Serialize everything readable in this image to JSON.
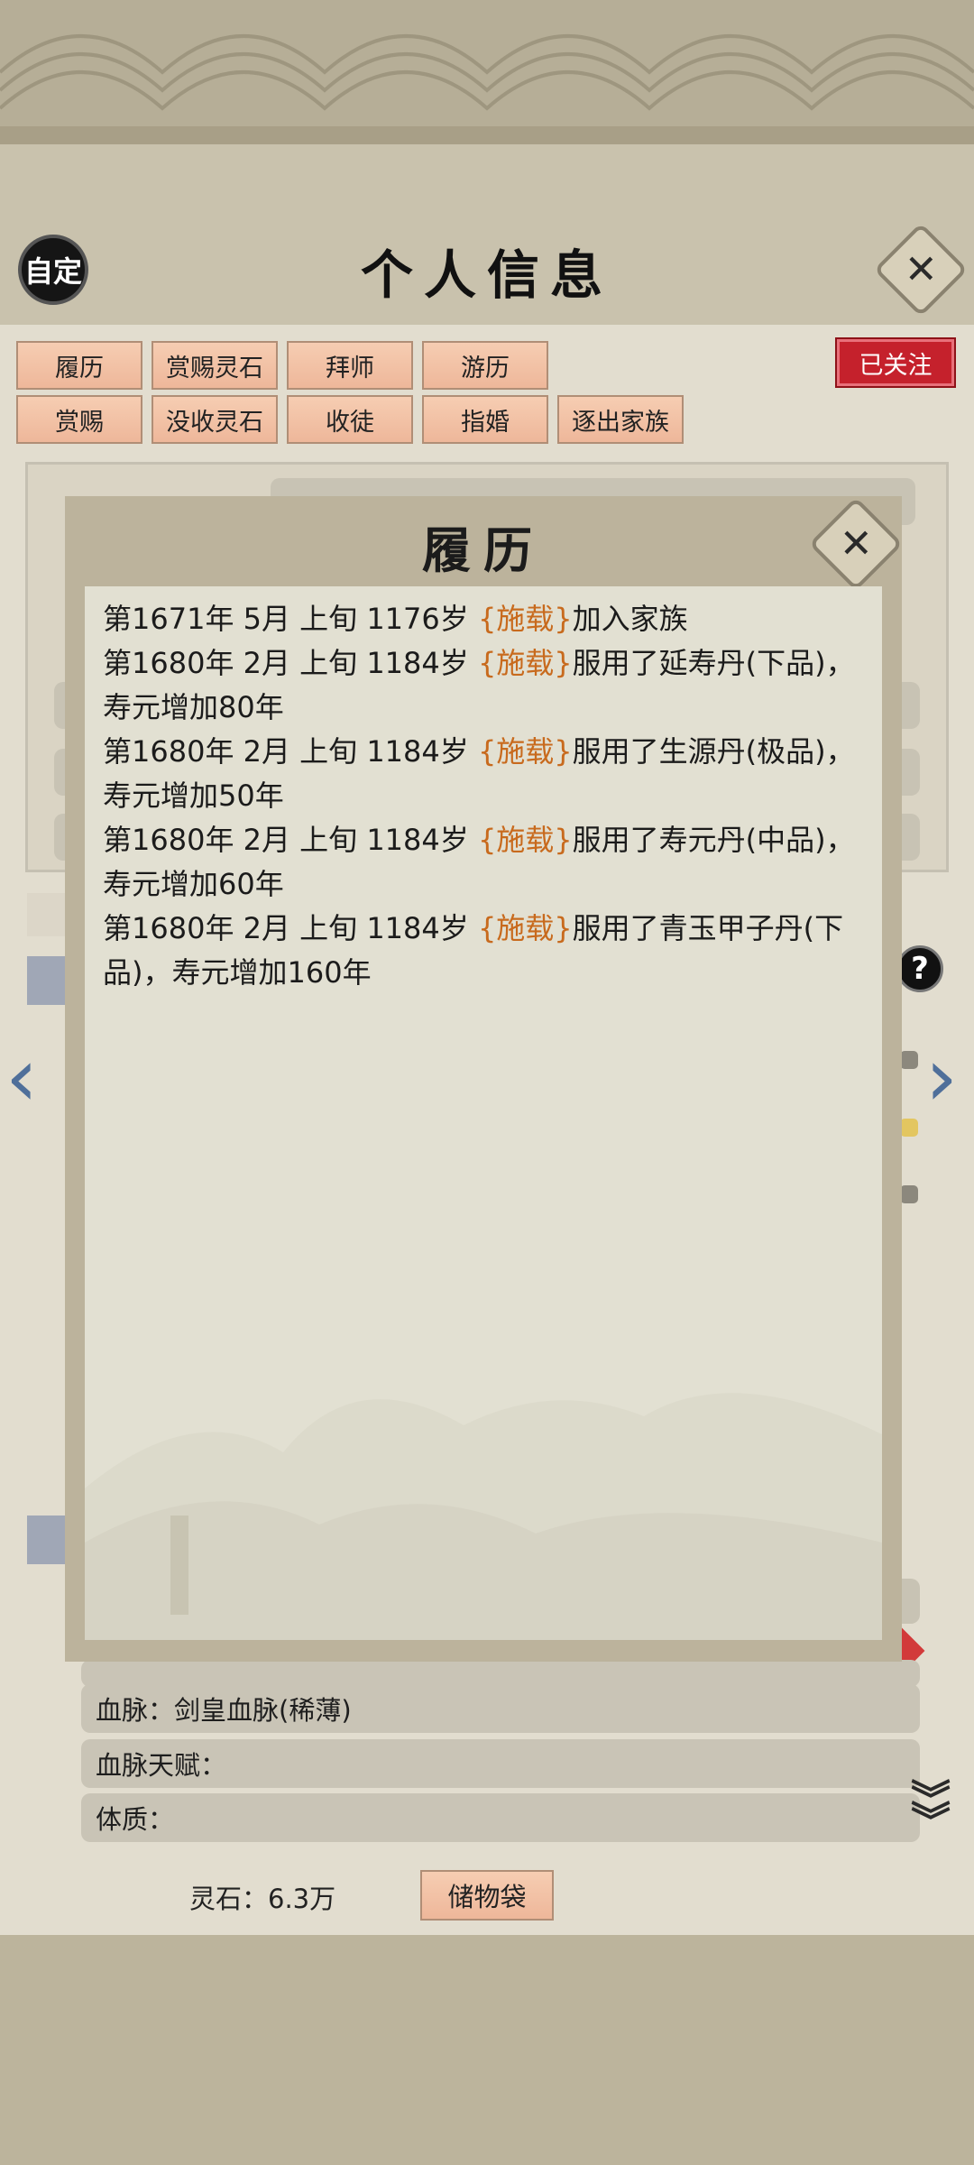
{
  "header": {
    "custom_btn": "自定",
    "title": "个人信息"
  },
  "actions": {
    "row1": [
      "履历",
      "赏赐灵石",
      "拜师",
      "游历"
    ],
    "row2": [
      "赏赐",
      "没收灵石",
      "收徒",
      "指婚",
      "逐出家族"
    ],
    "follow": "已关注"
  },
  "attributes": {
    "bloodline": "血脉：剑皇血脉(稀薄)",
    "bloodline_talent": "血脉天赋：",
    "physique": "体质："
  },
  "footer": {
    "spirit_stones": "灵石：6.3万",
    "storage_bag": "储物袋"
  },
  "modal": {
    "title": "履历",
    "entries": [
      {
        "prefix": "第1671年 5月 上旬  1176岁  ",
        "tag": "{施载}",
        "text": "加入家族"
      },
      {
        "prefix": "第1680年 2月 上旬  1184岁  ",
        "tag": "{施载}",
        "text": "服用了延寿丹(下品)，寿元增加80年"
      },
      {
        "prefix": "第1680年 2月 上旬  1184岁  ",
        "tag": "{施载}",
        "text": "服用了生源丹(极品)，寿元增加50年"
      },
      {
        "prefix": "第1680年 2月 上旬  1184岁  ",
        "tag": "{施载}",
        "text": "服用了寿元丹(中品)，寿元增加60年"
      },
      {
        "prefix": "第1680年 2月 上旬  1184岁 ",
        "tag": "{施载}",
        "text": "服用了青玉甲子丹(下品)，寿元增加160年"
      }
    ]
  },
  "colors": {
    "tag": "#c86a1d",
    "follow_badge": "#c5212c",
    "button": "#f2c3a7",
    "modal_frame": "#bcb39c"
  }
}
